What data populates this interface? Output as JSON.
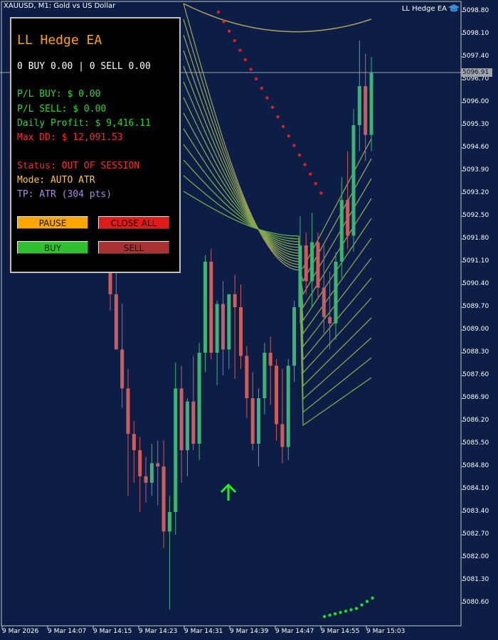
{
  "header": {
    "symbol_title": "XAUUSD, M1:  Gold vs US Dollar",
    "ea_name": "LL Hedge EA",
    "ea_icon": "graduation-cap-icon"
  },
  "price_axis": {
    "labels": [
      "5098.80",
      "5098.10",
      "5097.40",
      "5096.70",
      "5096.00",
      "5095.30",
      "5094.60",
      "5093.90",
      "5093.20",
      "5092.50",
      "5091.80",
      "5091.10",
      "5090.40",
      "5089.70",
      "5089.00",
      "5088.30",
      "5087.60",
      "5086.90",
      "5086.20",
      "5085.50",
      "5084.80",
      "5084.10",
      "5083.40",
      "5082.70",
      "5082.00",
      "5081.30",
      "5080.60"
    ],
    "bid_label": "5096.91"
  },
  "time_axis": {
    "labels": [
      "9 Mar 2026",
      "9 Mar 14:07",
      "9 Mar 14:15",
      "9 Mar 14:23",
      "9 Mar 14:31",
      "9 Mar 14:39",
      "9 Mar 14:47",
      "9 Mar 14:55",
      "9 Mar 15:03"
    ]
  },
  "panel": {
    "title": "LL Hedge EA",
    "positions": "0 BUY 0.00 | 0 SELL 0.00",
    "pl_buy": "P/L BUY: $ 0.00",
    "pl_sell": "P/L SELL: $ 0.00",
    "daily_profit": "Daily Profit: $ 9,416.11",
    "max_dd": "Max DD: $ 12,091.53",
    "status": "Status: OUT OF SESSION",
    "mode": "Mode: AUTO ATR",
    "tp": "TP: ATR (304 pts)",
    "buttons": {
      "pause": "PAUSE",
      "close_all": "CLOSE ALL",
      "buy": "BUY",
      "sell": "SELL"
    }
  },
  "colors": {
    "background": "#0c1e45",
    "bull_candle": "#3cb371",
    "bear_candle": "#cd5c5c",
    "ma_ribbon": "#9a9a5a",
    "sar_red": "#e02020",
    "sar_green": "#22dd22"
  },
  "chart_data": {
    "type": "candlestick",
    "symbol": "XAUUSD",
    "timeframe": "M1",
    "ylim": [
      5080.2,
      5099.1
    ],
    "current_price": 5096.91,
    "buy_arrow_price": 5084.15,
    "candles": [
      {
        "o": 5091.9,
        "h": 5092.3,
        "l": 5089.6,
        "c": 5090.1
      },
      {
        "o": 5090.1,
        "h": 5091.1,
        "l": 5088.4,
        "c": 5088.4
      },
      {
        "o": 5088.4,
        "h": 5089.8,
        "l": 5086.6,
        "c": 5087.2
      },
      {
        "o": 5087.2,
        "h": 5087.8,
        "l": 5083.9,
        "c": 5085.8
      },
      {
        "o": 5085.8,
        "h": 5086.2,
        "l": 5084.3,
        "c": 5085.3
      },
      {
        "o": 5085.3,
        "h": 5085.7,
        "l": 5083.4,
        "c": 5084.5
      },
      {
        "o": 5084.5,
        "h": 5085.1,
        "l": 5083.7,
        "c": 5084.3
      },
      {
        "o": 5084.3,
        "h": 5085.5,
        "l": 5083.9,
        "c": 5084.9
      },
      {
        "o": 5084.9,
        "h": 5085.6,
        "l": 5083.6,
        "c": 5084.8
      },
      {
        "o": 5084.8,
        "h": 5085.6,
        "l": 5082.3,
        "c": 5082.8
      },
      {
        "o": 5082.8,
        "h": 5083.9,
        "l": 5080.4,
        "c": 5083.4
      },
      {
        "o": 5083.4,
        "h": 5088.0,
        "l": 5082.7,
        "c": 5087.2
      },
      {
        "o": 5087.2,
        "h": 5087.9,
        "l": 5084.3,
        "c": 5085.3
      },
      {
        "o": 5085.3,
        "h": 5086.9,
        "l": 5084.5,
        "c": 5086.8
      },
      {
        "o": 5086.8,
        "h": 5088.2,
        "l": 5085.3,
        "c": 5085.5
      },
      {
        "o": 5085.5,
        "h": 5088.6,
        "l": 5085.0,
        "c": 5088.3
      },
      {
        "o": 5088.3,
        "h": 5091.3,
        "l": 5087.7,
        "c": 5091.1
      },
      {
        "o": 5091.1,
        "h": 5091.5,
        "l": 5088.1,
        "c": 5088.3
      },
      {
        "o": 5088.3,
        "h": 5089.9,
        "l": 5087.3,
        "c": 5089.8
      },
      {
        "o": 5089.8,
        "h": 5090.5,
        "l": 5087.6,
        "c": 5088.4
      },
      {
        "o": 5088.4,
        "h": 5090.1,
        "l": 5087.8,
        "c": 5090.1
      },
      {
        "o": 5090.1,
        "h": 5090.7,
        "l": 5087.5,
        "c": 5089.7
      },
      {
        "o": 5089.7,
        "h": 5090.4,
        "l": 5087.8,
        "c": 5088.2
      },
      {
        "o": 5088.2,
        "h": 5088.5,
        "l": 5086.3,
        "c": 5086.9
      },
      {
        "o": 5086.9,
        "h": 5087.7,
        "l": 5085.3,
        "c": 5085.5
      },
      {
        "o": 5085.5,
        "h": 5087.2,
        "l": 5084.8,
        "c": 5086.9
      },
      {
        "o": 5086.9,
        "h": 5088.6,
        "l": 5086.4,
        "c": 5088.3
      },
      {
        "o": 5088.3,
        "h": 5088.8,
        "l": 5086.7,
        "c": 5087.9
      },
      {
        "o": 5087.9,
        "h": 5088.1,
        "l": 5085.6,
        "c": 5086.1
      },
      {
        "o": 5086.1,
        "h": 5087.8,
        "l": 5084.9,
        "c": 5085.4
      },
      {
        "o": 5085.4,
        "h": 5088.1,
        "l": 5085.0,
        "c": 5087.9
      },
      {
        "o": 5087.9,
        "h": 5089.9,
        "l": 5087.4,
        "c": 5089.7
      },
      {
        "o": 5089.7,
        "h": 5092.5,
        "l": 5089.2,
        "c": 5091.6
      },
      {
        "o": 5091.6,
        "h": 5092.0,
        "l": 5090.1,
        "c": 5090.5
      },
      {
        "o": 5090.5,
        "h": 5092.6,
        "l": 5089.7,
        "c": 5091.7
      },
      {
        "o": 5091.7,
        "h": 5092.0,
        "l": 5090.0,
        "c": 5090.3
      },
      {
        "o": 5090.3,
        "h": 5091.6,
        "l": 5088.9,
        "c": 5089.4
      },
      {
        "o": 5089.4,
        "h": 5090.8,
        "l": 5088.4,
        "c": 5089.2
      },
      {
        "o": 5089.2,
        "h": 5091.4,
        "l": 5088.7,
        "c": 5091.1
      },
      {
        "o": 5091.1,
        "h": 5093.7,
        "l": 5090.6,
        "c": 5093.0
      },
      {
        "o": 5093.0,
        "h": 5094.5,
        "l": 5091.5,
        "c": 5091.9
      },
      {
        "o": 5091.9,
        "h": 5095.8,
        "l": 5091.4,
        "c": 5095.3
      },
      {
        "o": 5095.3,
        "h": 5097.9,
        "l": 5094.5,
        "c": 5096.5
      },
      {
        "o": 5096.5,
        "h": 5097.5,
        "l": 5094.2,
        "c": 5095.0
      },
      {
        "o": 5095.0,
        "h": 5097.4,
        "l": 5094.5,
        "c": 5096.9
      }
    ]
  }
}
